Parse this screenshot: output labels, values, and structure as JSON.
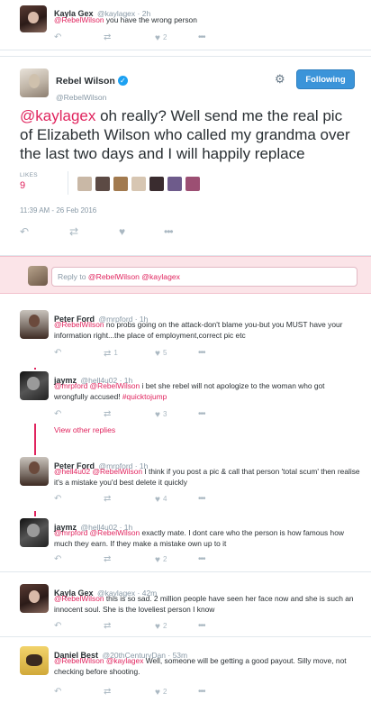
{
  "top_tweet": {
    "name": "Kayla Gex",
    "handle": "@kaylagex · 2h",
    "text_mention": "@RebelWilson",
    "text_rest": " you have the wrong person",
    "retweets": "",
    "likes": "2"
  },
  "main_tweet": {
    "name": "Rebel Wilson",
    "handle": "@RebelWilson",
    "follow_label": "Following",
    "text_mention": "@kaylagex",
    "text_rest": " oh really? Well send me the real pic of Elizabeth Wilson who called my grandma over the last two days and I will happily replace",
    "likes_label": "LIKES",
    "likes_count": "9",
    "timestamp": "11:39 AM - 26 Feb 2016"
  },
  "reply_box": {
    "prefix": "Reply to ",
    "mention1": "@RebelWilson",
    "mention2": "@kaylagex"
  },
  "replies": [
    {
      "name": "Peter Ford",
      "handle": "@mrpford · 1h",
      "mentions": "@RebelWilson",
      "text": " no probs going on the attack-don't blame you-but you MUST have your information right...the place of employment,correct pic etc",
      "retweets": "1",
      "likes": "5"
    },
    {
      "name": "jaymz",
      "handle": "@hell4u02 · 1h",
      "mentions": "@mrpford @RebelWilson",
      "text": " i bet she rebel will not apologize to the woman who got wrongfully accused! ",
      "hashtag": "#quicktojump",
      "retweets": "",
      "likes": "3"
    },
    {
      "name": "Peter Ford",
      "handle": "@mrpford · 1h",
      "mentions": "@hell4u02 @RebelWilson",
      "text": " I think if you post a pic & call that person 'total scum' then realise it's a mistake you'd best delete it quickly",
      "retweets": "",
      "likes": "4"
    },
    {
      "name": "jaymz",
      "handle": "@hell4u02 · 1h",
      "mentions": "@mrpford @RebelWilson",
      "text": " exactly mate. I dont care who the person is how famous how much they earn. If they make a mistake own up to it",
      "retweets": "",
      "likes": "2"
    },
    {
      "name": "Kayla Gex",
      "handle": "@kaylagex · 42m",
      "mentions": "@RebelWilson",
      "text": " this is so sad. 2 million people have seen her face now and she is such an innocent soul. She is the loveliest person I know",
      "retweets": "",
      "likes": "2"
    },
    {
      "name": "Daniel Best",
      "handle": "@20thCenturyDan · 53m",
      "mentions": "@RebelWilson @kaylagex",
      "text": " Well, someone will be getting a good payout. Silly move, not checking before shooting.",
      "retweets": "",
      "likes": "2"
    }
  ],
  "view_other_replies": "View other replies",
  "icons": {
    "reply": "reply-icon",
    "retweet": "retweet-icon",
    "like": "heart-icon",
    "more": "more-icon",
    "settings": "gear-icon",
    "verified": "verified-icon"
  },
  "colors": {
    "accent": "#e0245e",
    "follow": "#3b94d9"
  }
}
